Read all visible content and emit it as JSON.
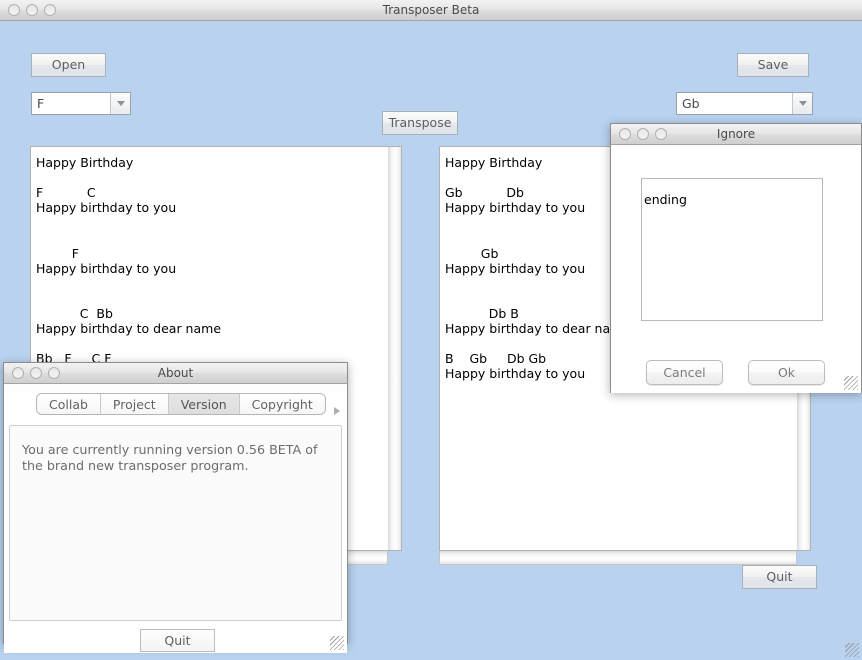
{
  "main_window": {
    "title": "Transposer Beta",
    "traffic_lights": [
      "close-light",
      "minimize-light",
      "zoom-light"
    ],
    "open_button": "Open",
    "save_button": "Save",
    "transpose_button": "Transpose",
    "quit_button": "Quit",
    "source_key_combo": {
      "value": "F"
    },
    "target_key_combo": {
      "value": "Gb"
    },
    "source_text": "Happy Birthday\n\nF           C\nHappy birthday to you\n\n\n         F\nHappy birthday to you\n\n\n           C  Bb\nHappy birthday to dear name\n\nBb   F     C F\nHappy birthday to you",
    "target_text": "Happy Birthday\n\nGb           Db\nHappy birthday to you\n\n\n         Gb\nHappy birthday to you\n\n\n           Db B\nHappy birthday to dear name\n\nB    Gb     Db Gb\nHappy birthday to you"
  },
  "ignore_window": {
    "title": "Ignore",
    "textarea_value": "ending",
    "cancel_button": "Cancel",
    "ok_button": "Ok"
  },
  "about_window": {
    "title": "About",
    "tabs": [
      {
        "label": "Collab",
        "selected": false
      },
      {
        "label": "Project",
        "selected": false
      },
      {
        "label": "Version",
        "selected": true
      },
      {
        "label": "Copyright",
        "selected": false
      }
    ],
    "body_text": "You are currently running version 0.56 BETA of the brand new transposer program.",
    "quit_button": "Quit"
  },
  "colors": {
    "desktop_background": "#b9d2ef",
    "titlebar_top": "#f2f2f2",
    "titlebar_bottom": "#cfcfcf",
    "text_color": "#000000",
    "muted_label": "#6c6c6c"
  }
}
